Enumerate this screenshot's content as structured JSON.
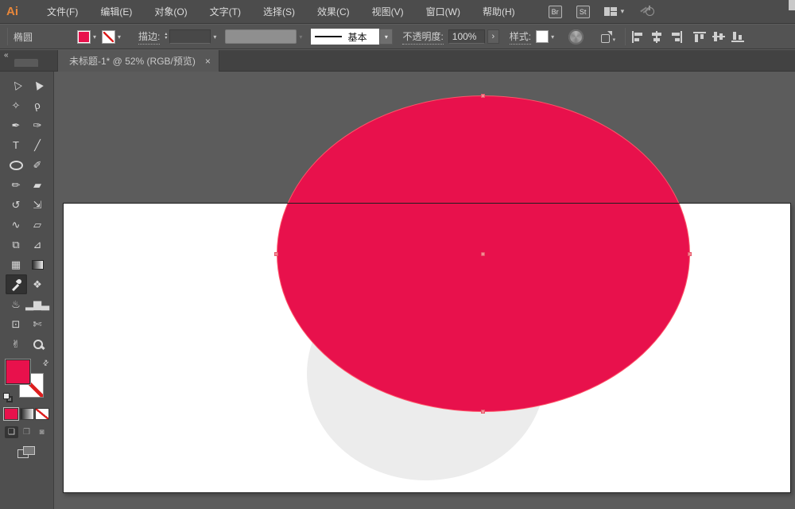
{
  "menubar": {
    "logo": "Ai",
    "items": [
      "文件(F)",
      "编辑(E)",
      "对象(O)",
      "文字(T)",
      "选择(S)",
      "效果(C)",
      "视图(V)",
      "窗口(W)",
      "帮助(H)"
    ],
    "bridge_button": "Br",
    "stock_button": "St"
  },
  "control_bar": {
    "context_label": "椭圆",
    "stroke_label": "描边:",
    "brush_basic_label": "基本",
    "opacity_label": "不透明度:",
    "opacity_value": "100%",
    "opacity_next_arrow": "›",
    "style_label": "样式:"
  },
  "tabbar": {
    "collapse_glyph": "«",
    "doc_tab": {
      "title": "未标题-1* @ 52% (RGB/预览)",
      "close_glyph": "×",
      "zoom_percent": "52%",
      "color_mode": "RGB/预览"
    }
  },
  "tools": [
    {
      "id": "selection-tool",
      "glyph": "▷",
      "rotate": -125
    },
    {
      "id": "direct-selection-tool",
      "glyph": "▶",
      "rotate": -125
    },
    {
      "id": "magic-wand-tool",
      "glyph": "✧"
    },
    {
      "id": "lasso-tool",
      "glyph": "ρ",
      "rotate": -15
    },
    {
      "id": "pen-tool",
      "glyph": "✒"
    },
    {
      "id": "curvature-tool",
      "glyph": "✑"
    },
    {
      "id": "type-tool",
      "glyph": "T"
    },
    {
      "id": "line-segment-tool",
      "glyph": "╱"
    },
    {
      "id": "ellipse-tool",
      "css": "ti-ellipse"
    },
    {
      "id": "paintbrush-tool",
      "glyph": "✐"
    },
    {
      "id": "pencil-tool",
      "glyph": "✏"
    },
    {
      "id": "eraser-tool",
      "glyph": "▰"
    },
    {
      "id": "rotate-tool",
      "glyph": "↺"
    },
    {
      "id": "scale-tool",
      "glyph": "⇲"
    },
    {
      "id": "width-tool",
      "glyph": "∿"
    },
    {
      "id": "free-transform-tool",
      "glyph": "▱"
    },
    {
      "id": "shape-builder-tool",
      "glyph": "⧉"
    },
    {
      "id": "perspective-grid-tool",
      "glyph": "⊿"
    },
    {
      "id": "mesh-tool",
      "glyph": "▦"
    },
    {
      "id": "gradient-tool",
      "css": "ti-gradient"
    },
    {
      "id": "eyedropper-tool",
      "css": "ti-eyedropper",
      "active": true
    },
    {
      "id": "blend-tool",
      "glyph": "❖"
    },
    {
      "id": "symbol-sprayer-tool",
      "glyph": "♨"
    },
    {
      "id": "column-graph-tool",
      "glyph": "▂▆▃"
    },
    {
      "id": "artboard-tool",
      "glyph": "⊡"
    },
    {
      "id": "slice-tool",
      "glyph": "✄"
    },
    {
      "id": "hand-tool",
      "glyph": "✌"
    },
    {
      "id": "zoom-tool",
      "css": "ti-zoom"
    }
  ],
  "colors": {
    "fill_crimson": "#e8114c",
    "gray_circle": "#ececec",
    "selection_anchor": "#f58a93",
    "selection_outline": "#ff5468",
    "ui_dark": "#4c4c4c",
    "pasteboard": "#5c5c5c",
    "logo_orange": "#e8873a"
  },
  "proxy": {
    "swap_glyph": "⇄"
  },
  "drawing_modes": {
    "normal": "❑",
    "behind": "❒",
    "inside": "◙"
  }
}
